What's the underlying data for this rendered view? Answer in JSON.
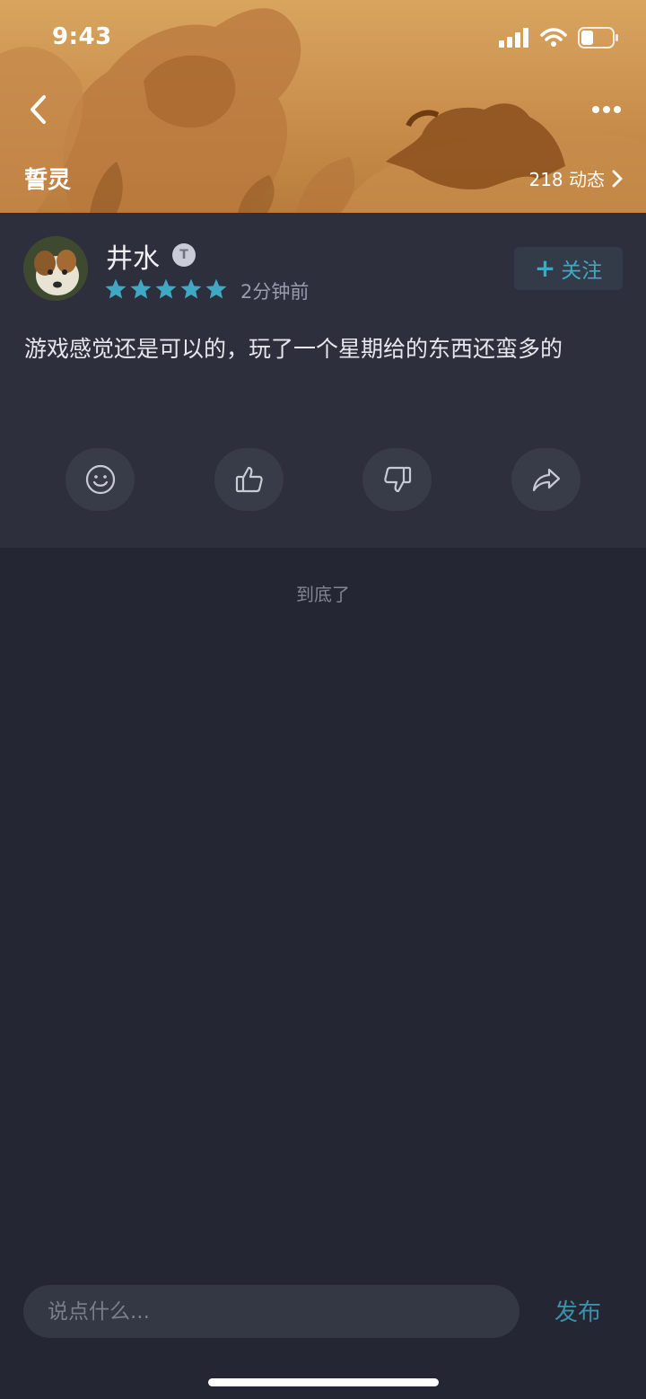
{
  "status_bar": {
    "time": "9:43",
    "icons": [
      "signal-icon",
      "wifi-icon",
      "battery-icon"
    ]
  },
  "header": {
    "game_name": "誓灵",
    "logo_text": "誓灵",
    "dynamics_label": "218 动态",
    "back_icon": "chevron-left-icon",
    "more_icon": "more-dots-icon"
  },
  "post": {
    "username": "井水",
    "badge_text": "T",
    "rating": 5,
    "rating_max": 5,
    "time_ago": "2分钟前",
    "follow_label": "关注",
    "content": "游戏感觉还是可以的，玩了一个星期给的东西还蛮多的",
    "actions": [
      "emoji-icon",
      "thumbs-up-icon",
      "thumbs-down-icon",
      "share-icon"
    ]
  },
  "feed": {
    "end_text": "到底了"
  },
  "comment_bar": {
    "placeholder": "说点什么...",
    "publish_label": "发布"
  },
  "colors": {
    "accent": "#3fa9c4",
    "background": "#242633",
    "card": "#2d2f3c",
    "star": "#3fa9c4"
  }
}
